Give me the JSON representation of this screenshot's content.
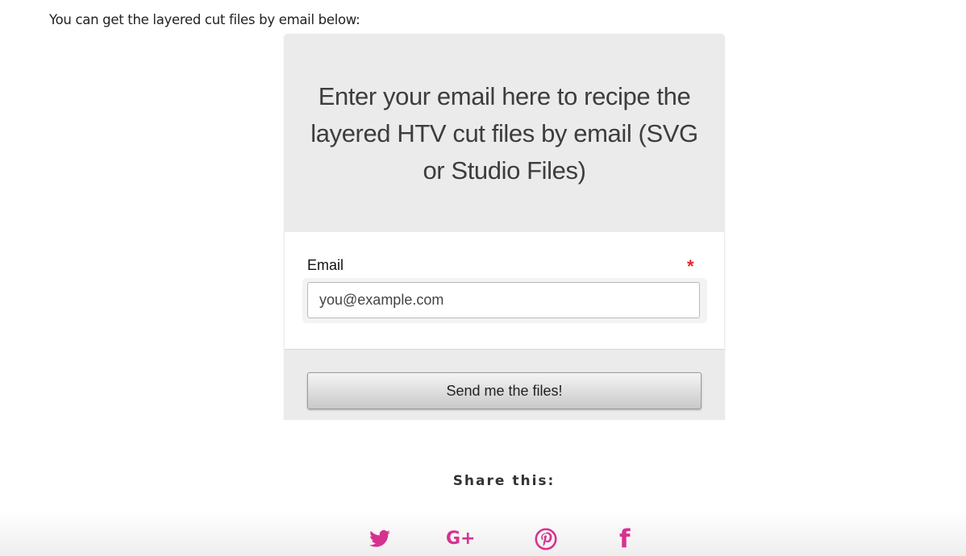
{
  "intro_text": "You can get the layered cut files by email below:",
  "form": {
    "heading": "Enter your email here to recipe the layered HTV cut files by email (SVG or Studio Files)",
    "email_label": "Email",
    "required_marker": "*",
    "email_placeholder": "you@example.com",
    "submit_label": "Send me the files!"
  },
  "share": {
    "title": "Share this:",
    "icons": [
      "twitter-icon",
      "google-plus-icon",
      "pinterest-icon",
      "facebook-icon"
    ],
    "gplus_glyph": "G+",
    "facebook_glyph": "f",
    "icon_color": "#d7318f"
  },
  "colors": {
    "accent": "#d7318f",
    "required": "#e2252b",
    "card_background": "#ebebeb"
  }
}
